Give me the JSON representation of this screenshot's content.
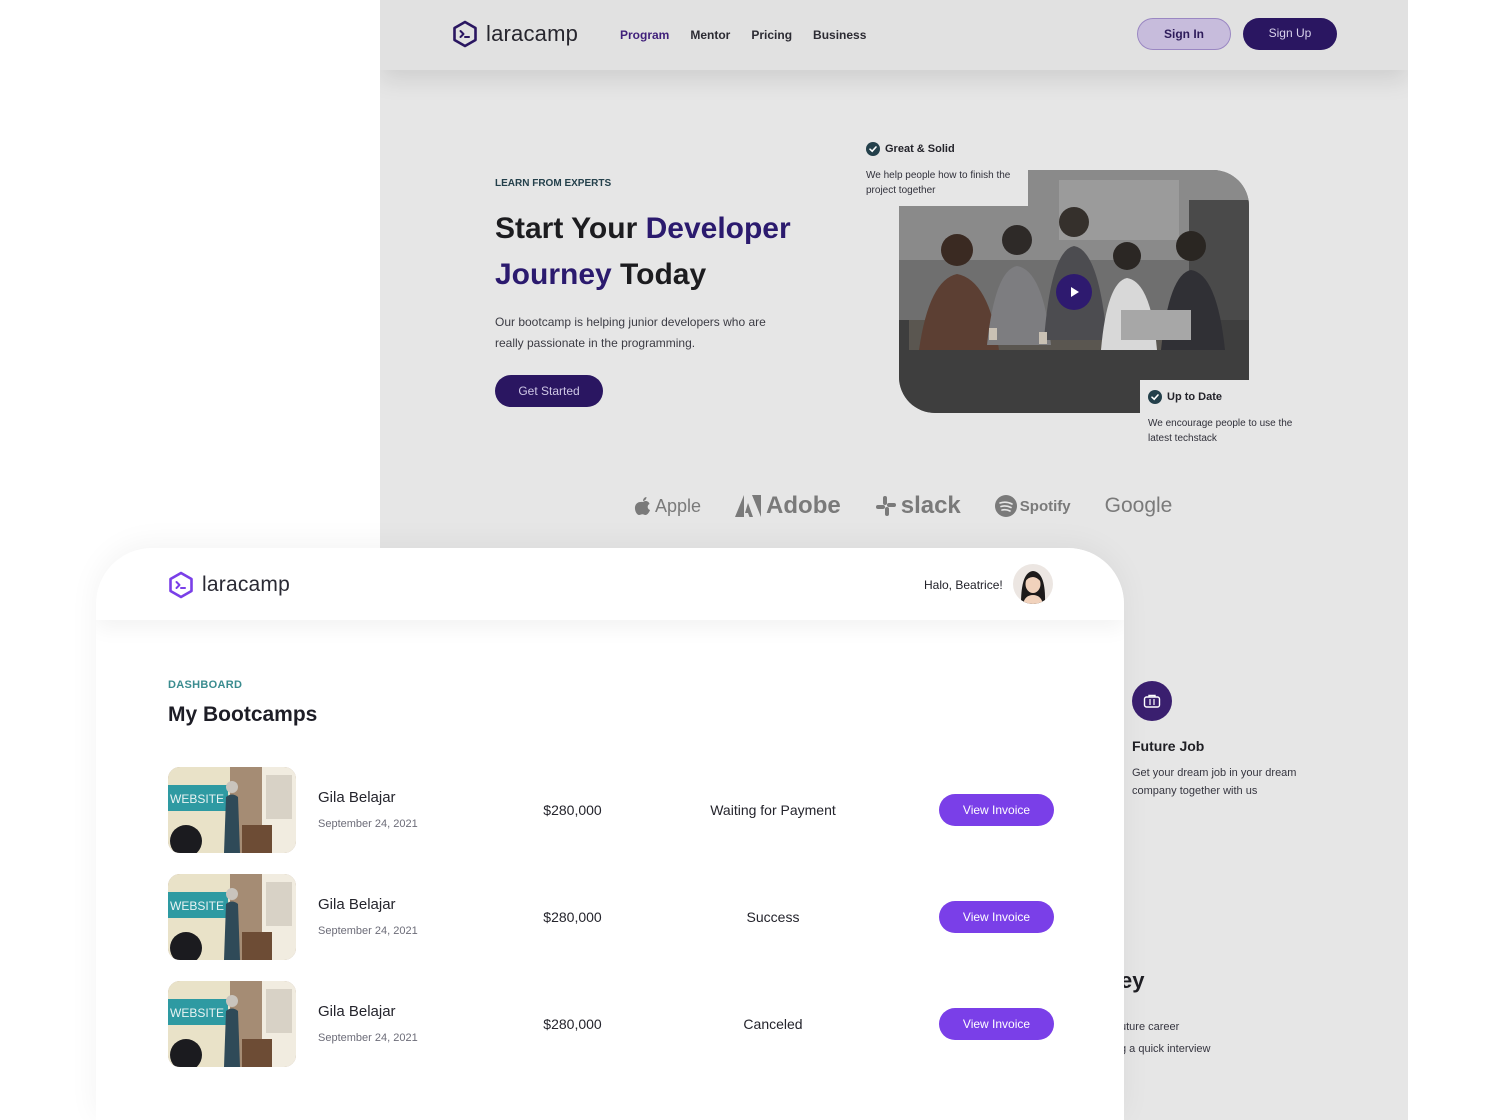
{
  "landing": {
    "brand": "laracamp",
    "nav": [
      {
        "label": "Program",
        "active": true
      },
      {
        "label": "Mentor",
        "active": false
      },
      {
        "label": "Pricing",
        "active": false
      },
      {
        "label": "Business",
        "active": false
      }
    ],
    "signin_label": "Sign In",
    "signup_label": "Sign Up",
    "hero": {
      "kicker": "LEARN FROM EXPERTS",
      "title_part1": "Start Your ",
      "title_accent1": "Developer",
      "title_accent2": "Journey",
      "title_part2": " Today",
      "description": "Our bootcamp is helping junior developers who are really passionate in the programming.",
      "cta_label": "Get Started"
    },
    "callout_top": {
      "title": "Great & Solid",
      "text": "We help people how to finish the project together"
    },
    "callout_bottom": {
      "title": "Up to Date",
      "text": "We encourage people to use the latest techstack"
    },
    "brands": [
      "Apple",
      "Adobe",
      "slack",
      "Spotify",
      "Google"
    ],
    "feature": {
      "title": "Future Job",
      "text": "Get your dream job in your dream company together with us"
    },
    "fragment": {
      "title": "ey",
      "line1": "uture career",
      "line2": "g a quick interview"
    }
  },
  "dashboard": {
    "brand": "laracamp",
    "greeting": "Halo, Beatrice!",
    "kicker": "DASHBOARD",
    "title": "My Bootcamps",
    "rows": [
      {
        "name": "Gila Belajar",
        "date": "September 24, 2021",
        "price": "$280,000",
        "status": "Waiting for Payment",
        "action": "View Invoice"
      },
      {
        "name": "Gila Belajar",
        "date": "September 24, 2021",
        "price": "$280,000",
        "status": "Success",
        "action": "View Invoice"
      },
      {
        "name": "Gila Belajar",
        "date": "September 24, 2021",
        "price": "$280,000",
        "status": "Canceled",
        "action": "View Invoice"
      }
    ]
  },
  "colors": {
    "brand_dark": "#2a1661",
    "button_purple": "#7a3fe8",
    "kicker_teal": "#3a8c8f"
  }
}
